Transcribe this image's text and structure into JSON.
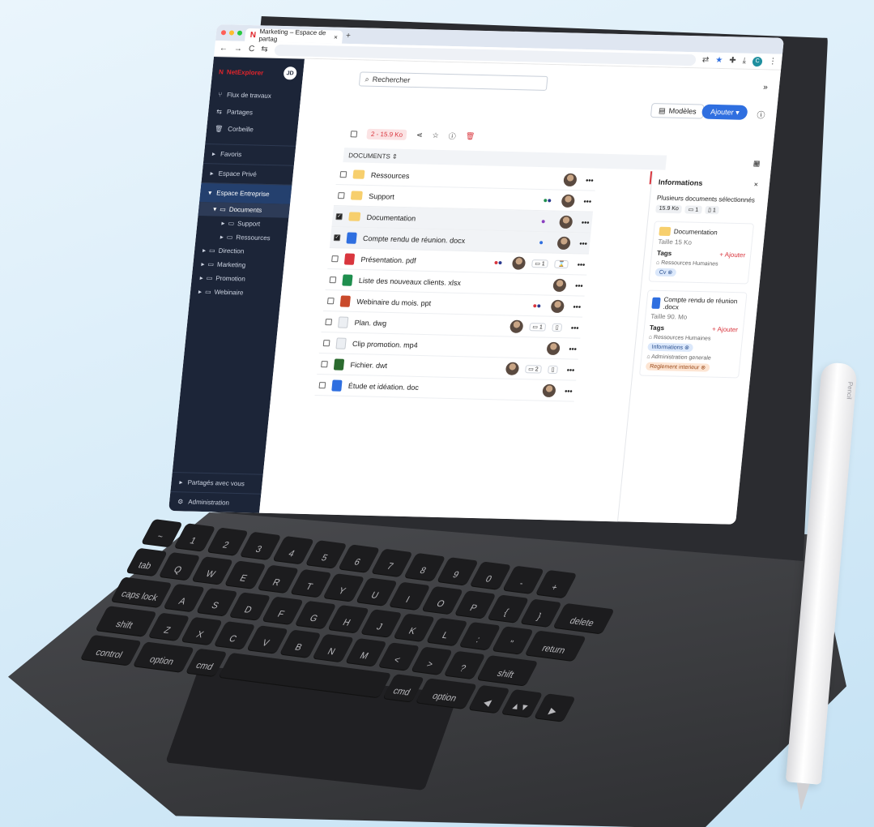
{
  "browser": {
    "tab_title": "Marketing – Espace de partag",
    "tab_close": "×",
    "new_tab": "+",
    "nav_back": "←",
    "nav_forward": "→",
    "reload": "C",
    "site_icon": "⇆",
    "apps": "⊞",
    "collapse": "⌄",
    "profile_initial": "C"
  },
  "sidebar": {
    "brand": "NetExplorer",
    "user_initials": "JD",
    "items": [
      {
        "label": "Flux de travaux"
      },
      {
        "label": "Partages"
      },
      {
        "label": "Corbeille"
      }
    ],
    "sections": [
      {
        "label": "Favoris"
      },
      {
        "label": "Espace Privé"
      },
      {
        "label": "Espace Entreprise"
      }
    ],
    "tree": [
      {
        "label": "Documents"
      },
      {
        "label": "Support"
      },
      {
        "label": "Ressources"
      },
      {
        "label": "Direction"
      },
      {
        "label": "Marketing"
      },
      {
        "label": "Promotion"
      },
      {
        "label": "Webinaire"
      }
    ],
    "shared_with_you": "Partagés avec vous",
    "administration": "Administration"
  },
  "main": {
    "search_placeholder": "Rechercher",
    "templates_label": "Modèles",
    "add_label": "Ajouter",
    "selection_label": "2 - 15.9 Ko",
    "list_header": "DOCUMENTS",
    "rows": [
      {
        "name": "Ressources",
        "type": "folder",
        "checked": false,
        "presence": [],
        "comments": "",
        "tasks": ""
      },
      {
        "name": "Support",
        "type": "folder",
        "checked": false,
        "presence": [
          "#1f8f4e",
          "#2b3a8f"
        ],
        "comments": "",
        "tasks": ""
      },
      {
        "name": "Documentation",
        "type": "folder",
        "checked": true,
        "presence": [
          "#8a3fbf"
        ],
        "comments": "",
        "tasks": ""
      },
      {
        "name": "Compte rendu de réunion. docx",
        "type": "word",
        "checked": true,
        "presence": [
          "#2f6fe0"
        ],
        "comments": "",
        "tasks": ""
      },
      {
        "name": "Présentation. pdf",
        "type": "pdf",
        "checked": false,
        "presence": [
          "#d9363e",
          "#2b3a8f"
        ],
        "comments": "1",
        "tasks": "⌛"
      },
      {
        "name": "Liste des nouveaux clients. xlsx",
        "type": "excel",
        "checked": false,
        "presence": [],
        "comments": "",
        "tasks": ""
      },
      {
        "name": "Webinaire du mois. ppt",
        "type": "ppt",
        "checked": false,
        "presence": [
          "#d9363e",
          "#2b3a8f"
        ],
        "comments": "",
        "tasks": ""
      },
      {
        "name": "Plan. dwg",
        "type": "plain",
        "checked": false,
        "presence": [],
        "comments": "1",
        "tasks": "doc"
      },
      {
        "name": "Clip promotion. mp4",
        "type": "plain",
        "checked": false,
        "presence": [],
        "comments": "",
        "tasks": ""
      },
      {
        "name": "Fichier. dwt",
        "type": "dwt",
        "checked": false,
        "presence": [],
        "comments": "2",
        "tasks": "doc"
      },
      {
        "name": "Étude et idéation. doc",
        "type": "word",
        "checked": false,
        "presence": [],
        "comments": "",
        "tasks": ""
      }
    ],
    "row_more": "•••"
  },
  "panel": {
    "title": "Informations",
    "multi_selected": "Plusieurs documents sélectionnés",
    "total_size": "15.9 Ko",
    "folder_count": "1",
    "file_count": "1",
    "cards": [
      {
        "name": "Documentation",
        "size": "Taille 15 Ko",
        "tags_label": "Tags",
        "add_label": "+ Ajouter",
        "groups": [
          {
            "name": "Ressources Humaines",
            "tags": [
              "Cv"
            ],
            "color": "blue"
          }
        ]
      },
      {
        "name": "Compte rendu de réunion .docx",
        "size": "Taille 90. Mo",
        "tags_label": "Tags",
        "add_label": "+ Ajouter",
        "groups": [
          {
            "name": "Ressources Humaines",
            "tags": [
              "Informations"
            ],
            "color": "blue"
          },
          {
            "name": "Administration generale",
            "tags": [
              "Reglement interieur"
            ],
            "color": "orange"
          }
        ]
      }
    ]
  },
  "keyboard": {
    "rows": [
      [
        "~",
        "1",
        "2",
        "3",
        "4",
        "5",
        "6",
        "7",
        "8",
        "9",
        "0",
        "-",
        "+"
      ],
      [
        "tab",
        "Q",
        "W",
        "E",
        "R",
        "T",
        "Y",
        "U",
        "I",
        "O",
        "P",
        "{",
        "}",
        "delete"
      ],
      [
        "caps lock",
        "A",
        "S",
        "D",
        "F",
        "G",
        "H",
        "J",
        "K",
        "L",
        ":",
        "\"",
        "return"
      ],
      [
        "shift",
        "Z",
        "X",
        "C",
        "V",
        "B",
        "N",
        "M",
        "<",
        ">",
        "?",
        "shift"
      ],
      [
        "control",
        "option",
        "cmd",
        " ",
        "cmd",
        "option",
        "◀",
        "▲▼",
        "▶"
      ]
    ]
  },
  "pencil": {
    "label": "Pencil"
  },
  "colors": {
    "sidebar_bg": "#1c2538",
    "accent": "#2f6fe0",
    "brand_red": "#e0252b"
  }
}
